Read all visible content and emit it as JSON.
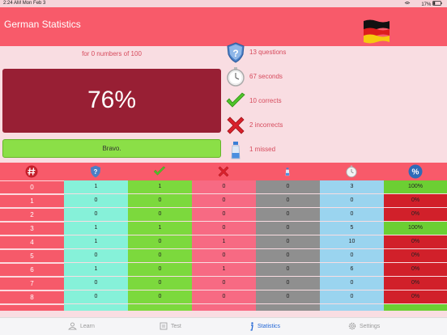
{
  "status_bar": {
    "time": "2:24 AM",
    "date": "Mon Feb 3",
    "battery": "17%"
  },
  "header": {
    "title": "German Statistics",
    "flag_icon": "germany-flag-icon"
  },
  "summary": {
    "subtitle": "for 0 numbers of 100",
    "score": "76%",
    "verdict": "Bravo."
  },
  "stats": [
    {
      "icon": "question-shield-icon",
      "text": "13 questions"
    },
    {
      "icon": "stopwatch-icon",
      "text": "67 seconds"
    },
    {
      "icon": "checkmark-icon",
      "text": "10 corrects"
    },
    {
      "icon": "cross-icon",
      "text": "2 incorrects"
    },
    {
      "icon": "bottle-icon",
      "text": "1 missed"
    }
  ],
  "table": {
    "columns": [
      "number",
      "questions",
      "corrects",
      "incorrects",
      "missed",
      "seconds",
      "percent"
    ],
    "header_icons": [
      "hash-icon",
      "question-shield-icon",
      "checkmark-icon",
      "cross-icon",
      "bottle-icon",
      "stopwatch-icon",
      "percent-icon"
    ],
    "rows": [
      {
        "n": "0",
        "q": "1",
        "c": "1",
        "i": "0",
        "m": "0",
        "s": "3",
        "p": "100%"
      },
      {
        "n": "1",
        "q": "0",
        "c": "0",
        "i": "0",
        "m": "0",
        "s": "0",
        "p": "0%"
      },
      {
        "n": "2",
        "q": "0",
        "c": "0",
        "i": "0",
        "m": "0",
        "s": "0",
        "p": "0%"
      },
      {
        "n": "3",
        "q": "1",
        "c": "1",
        "i": "0",
        "m": "0",
        "s": "5",
        "p": "100%"
      },
      {
        "n": "4",
        "q": "1",
        "c": "0",
        "i": "1",
        "m": "0",
        "s": "10",
        "p": "0%"
      },
      {
        "n": "5",
        "q": "0",
        "c": "0",
        "i": "0",
        "m": "0",
        "s": "0",
        "p": "0%"
      },
      {
        "n": "6",
        "q": "1",
        "c": "0",
        "i": "1",
        "m": "0",
        "s": "6",
        "p": "0%"
      },
      {
        "n": "7",
        "q": "0",
        "c": "0",
        "i": "0",
        "m": "0",
        "s": "0",
        "p": "0%"
      },
      {
        "n": "8",
        "q": "0",
        "c": "0",
        "i": "0",
        "m": "0",
        "s": "0",
        "p": "0%"
      }
    ]
  },
  "tabs": [
    {
      "label": "Learn",
      "icon": "learn-icon",
      "active": false
    },
    {
      "label": "Test",
      "icon": "test-icon",
      "active": false
    },
    {
      "label": "Statistics",
      "icon": "info-icon",
      "active": true
    },
    {
      "label": "Settings",
      "icon": "gear-icon",
      "active": false
    }
  ],
  "colors": {
    "accent": "#f85a6a",
    "score_bg": "#981f34",
    "bravo": "#8bdf47",
    "active_tab": "#2166d6"
  }
}
